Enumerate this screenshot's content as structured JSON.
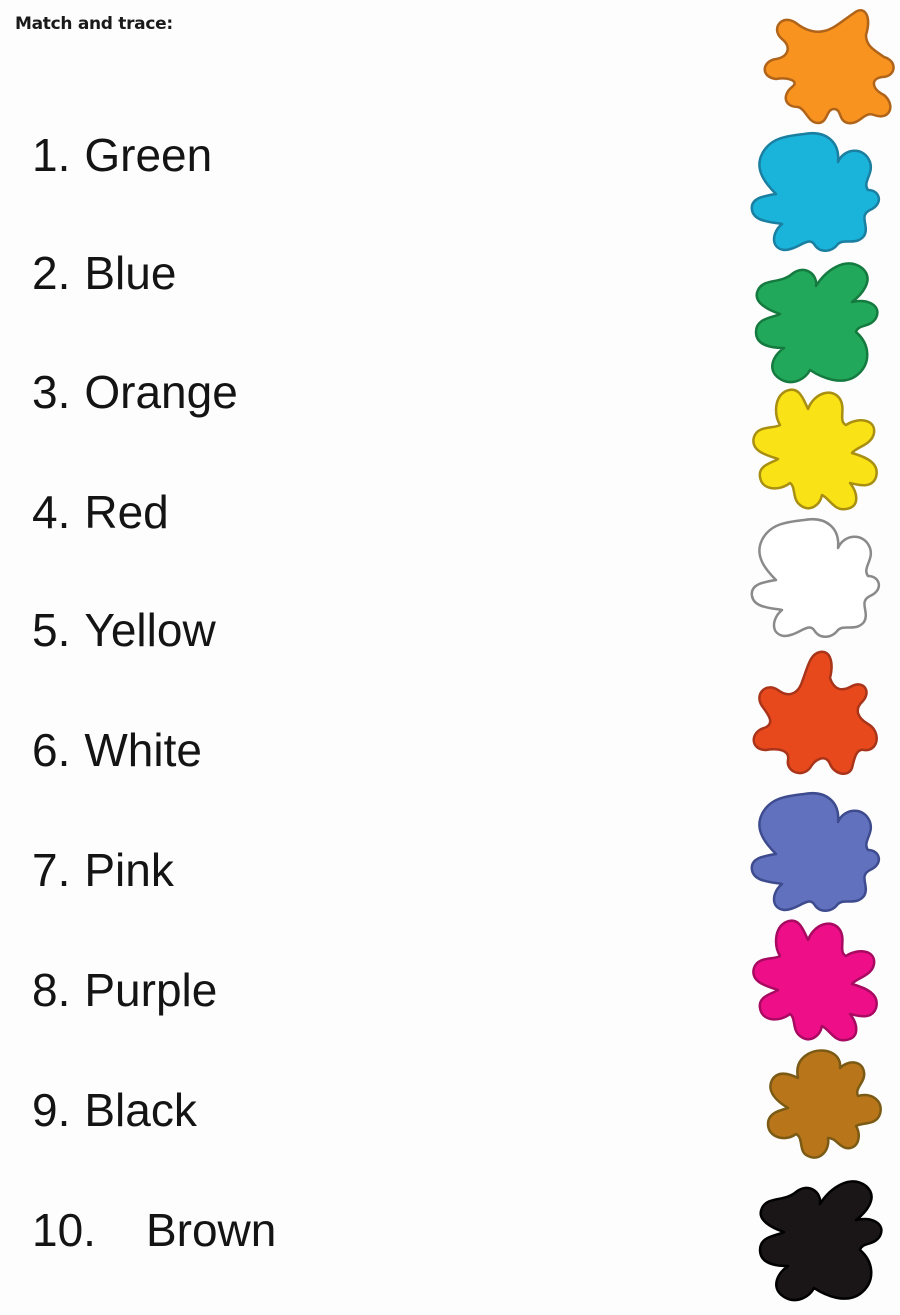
{
  "worksheet": {
    "title": "Match and trace:",
    "items": [
      {
        "number": "1.",
        "label": "Green"
      },
      {
        "number": "2.",
        "label": "Blue"
      },
      {
        "number": "3.",
        "label": "Orange"
      },
      {
        "number": "4.",
        "label": "Red"
      },
      {
        "number": "5.",
        "label": "Yellow"
      },
      {
        "number": "6.",
        "label": "White"
      },
      {
        "number": "7.",
        "label": "Pink"
      },
      {
        "number": "8.",
        "label": "Purple"
      },
      {
        "number": "9.",
        "label": "Black"
      },
      {
        "number": "10.",
        "label": "Brown"
      }
    ],
    "blots": [
      {
        "color_name": "orange",
        "fill": "#f7931e",
        "stroke": "#b0641a"
      },
      {
        "color_name": "blue",
        "fill": "#1ab3d9",
        "stroke": "#1a7fa0"
      },
      {
        "color_name": "green",
        "fill": "#22a85a",
        "stroke": "#157a3f"
      },
      {
        "color_name": "yellow",
        "fill": "#f9e215",
        "stroke": "#a88f12"
      },
      {
        "color_name": "white",
        "fill": "#ffffff",
        "stroke": "#8a8a8a"
      },
      {
        "color_name": "red",
        "fill": "#e8491c",
        "stroke": "#a8341a"
      },
      {
        "color_name": "purple",
        "fill": "#6271bd",
        "stroke": "#3e4c8f"
      },
      {
        "color_name": "pink",
        "fill": "#ee0f88",
        "stroke": "#a80a62"
      },
      {
        "color_name": "brown",
        "fill": "#b8751a",
        "stroke": "#7a5a14"
      },
      {
        "color_name": "black",
        "fill": "#1a1516",
        "stroke": "#000000"
      }
    ]
  }
}
